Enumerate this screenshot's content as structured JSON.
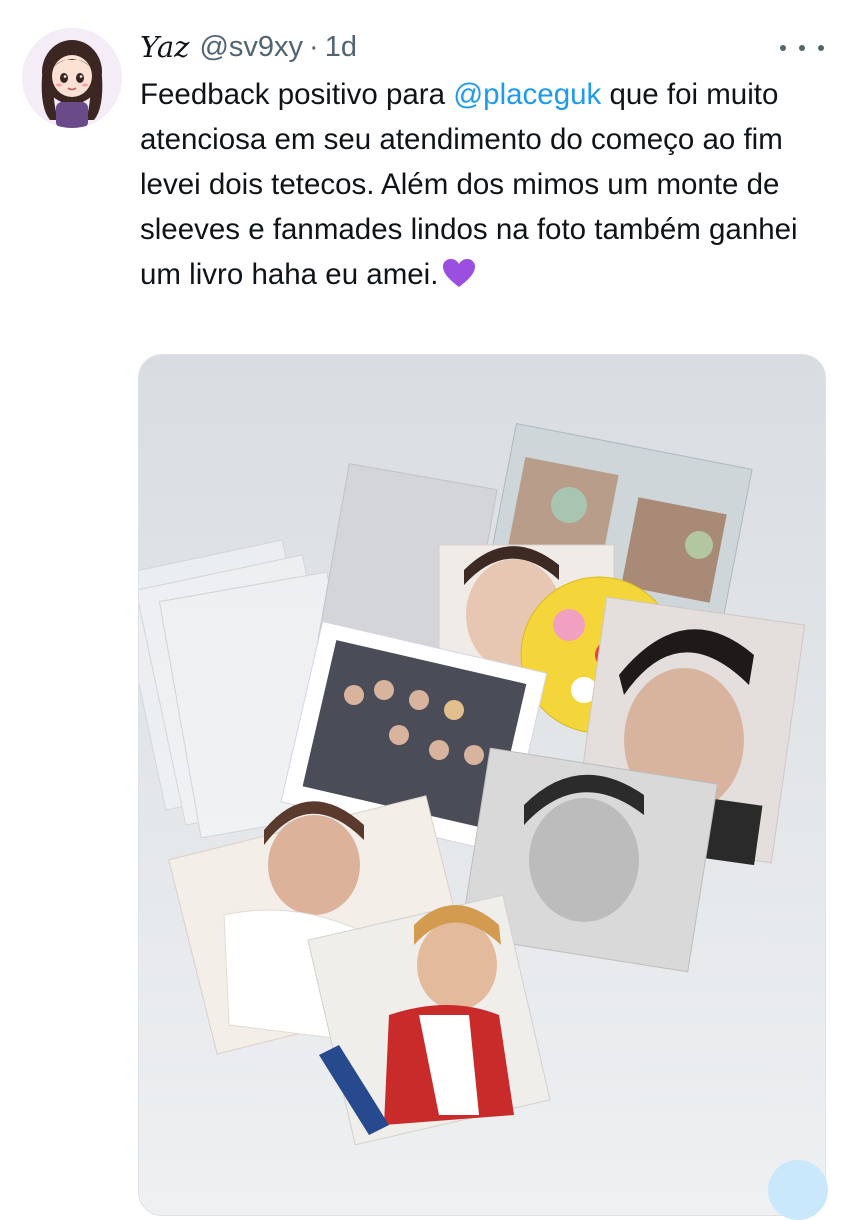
{
  "tweet": {
    "author_name": "Yaz",
    "handle": "@sv9xy",
    "separator": "·",
    "time": "1d",
    "text_parts": {
      "part1": "Feedback positivo para ",
      "mention": "@placeguk",
      "part2": " que foi muito atenciosa em seu atendimento do começo ao fim levei dois tetecos. Além dos mimos um monte de sleeves e fanmades lindos na foto também ganhei um livro haha eu amei."
    },
    "emoji": "purple-heart"
  },
  "icons": {
    "more": "more-horizontal-icon",
    "avatar": "chibi-avatar"
  },
  "colors": {
    "text": "#0f1419",
    "secondary": "#536471",
    "link": "#1d9bf0",
    "heart": "#9b4fe0"
  }
}
